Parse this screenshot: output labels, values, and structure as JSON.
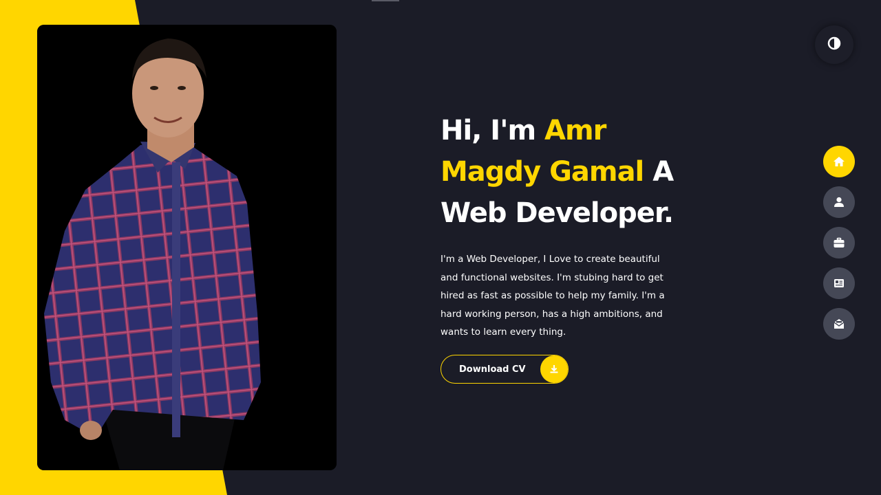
{
  "hero": {
    "headline_white_1": "Hi, I'm ",
    "headline_accent": "Amr Magdy Gamal",
    "headline_white_2": " A Web Developer.",
    "bio": "I'm a Web Developer, I Love to create beautiful and functional websites. I'm stubing hard to get hired as fast as possible to help my family. I'm a hard working person, has a high ambitions, and wants to learn every thing.",
    "cv_button_label": "Download CV",
    "cv_button_icon": "download-icon"
  },
  "theme_toggle": {
    "icon": "contrast-icon"
  },
  "nav": {
    "items": [
      {
        "id": "home",
        "icon": "home-icon",
        "active": true
      },
      {
        "id": "about",
        "icon": "user-icon",
        "active": false
      },
      {
        "id": "portfolio",
        "icon": "briefcase-icon",
        "active": false
      },
      {
        "id": "blog",
        "icon": "newspaper-icon",
        "active": false
      },
      {
        "id": "contact",
        "icon": "envelope-open-icon",
        "active": false
      }
    ]
  },
  "colors": {
    "background": "#1b1c27",
    "accent": "#ffd600",
    "nav_inactive": "#454856",
    "text": "#ffffff"
  }
}
